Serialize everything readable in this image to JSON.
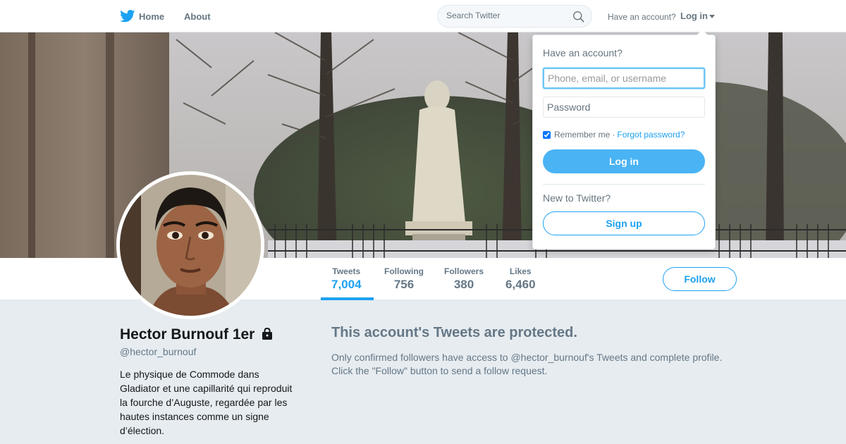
{
  "topbar": {
    "logo_icon": "twitter-bird-icon",
    "home_label": "Home",
    "about_label": "About",
    "search_placeholder": "Search Twitter",
    "search_icon": "search-icon",
    "have_account": "Have an account?",
    "login_label": "Log in"
  },
  "profile": {
    "name": "Hector Burnouf 1er",
    "protected_icon": "lock-icon",
    "handle": "@hector_burnouf",
    "bio": "Le physique de Commode dans Gladiator et une capillarité qui reproduit la fourche d’Auguste, regardée par les hautes instances comme un signe d’élection."
  },
  "stats": [
    {
      "label": "Tweets",
      "value": "7,004",
      "active": true
    },
    {
      "label": "Following",
      "value": "756",
      "active": false
    },
    {
      "label": "Followers",
      "value": "380",
      "active": false
    },
    {
      "label": "Likes",
      "value": "6,460",
      "active": false
    }
  ],
  "follow_label": "Follow",
  "protected": {
    "title": "This account's Tweets are protected.",
    "text": "Only confirmed followers have access to @hector_burnouf's Tweets and complete profile. Click the \"Follow\" button to send a follow request."
  },
  "login_dropdown": {
    "title": "Have an account?",
    "username_placeholder": "Phone, email, or username",
    "password_placeholder": "Password",
    "remember_label": "Remember me",
    "remember_checked": true,
    "separator": "·",
    "forgot_label": "Forgot password?",
    "login_button": "Log in",
    "new_label": "New to Twitter?",
    "signup_button": "Sign up"
  },
  "colors": {
    "accent": "#1da1f2",
    "login_button": "#4ab3f4",
    "page_bg": "#e6ecf0"
  }
}
